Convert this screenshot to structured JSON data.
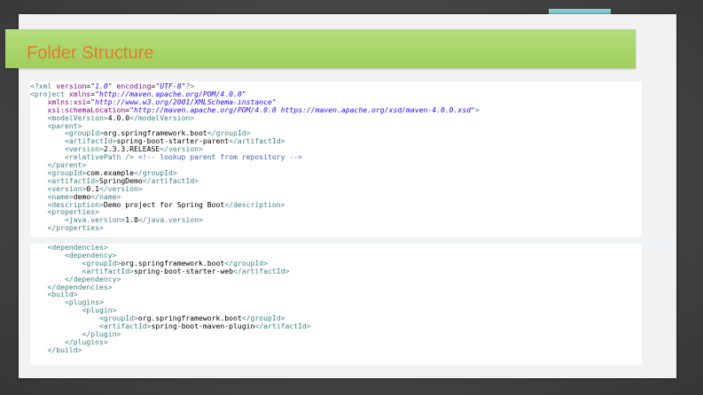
{
  "slide": {
    "title": "Folder Structure",
    "colors": {
      "title_bar": "#a8d468",
      "title_text": "#e8792a",
      "accent_tab": "#86cfd7",
      "background": "#454545"
    }
  },
  "code": {
    "lines": [
      [
        [
          "pi",
          "<?xml "
        ],
        [
          "attr",
          "version"
        ],
        [
          "txt",
          "="
        ],
        [
          "val",
          "\"1.0\""
        ],
        [
          "txt",
          " "
        ],
        [
          "attr",
          "encoding"
        ],
        [
          "txt",
          "="
        ],
        [
          "val",
          "\"UTF-8\""
        ],
        [
          "pi",
          "?>"
        ]
      ],
      [
        [
          "tag",
          "<project "
        ],
        [
          "attr",
          "xmlns"
        ],
        [
          "txt",
          "="
        ],
        [
          "val",
          "\"http://maven.apache.org/POM/4.0.0\""
        ]
      ],
      [
        [
          "txt",
          "    "
        ],
        [
          "attr",
          "xmlns:xsi"
        ],
        [
          "txt",
          "="
        ],
        [
          "val",
          "\"http://www.w3.org/2001/XMLSchema-instance\""
        ]
      ],
      [
        [
          "txt",
          "    "
        ],
        [
          "attr",
          "xsi:schemaLocation"
        ],
        [
          "txt",
          "="
        ],
        [
          "val",
          "\"http://maven.apache.org/POM/4.0.0 https://maven.apache.org/xsd/maven-4.0.0.xsd\""
        ],
        [
          "tag",
          ">"
        ]
      ],
      [
        [
          "txt",
          "    "
        ],
        [
          "tag",
          "<modelVersion>"
        ],
        [
          "txt",
          "4.0.0"
        ],
        [
          "tag",
          "</modelVersion>"
        ]
      ],
      [
        [
          "txt",
          "    "
        ],
        [
          "tag",
          "<parent>"
        ]
      ],
      [
        [
          "txt",
          "        "
        ],
        [
          "tag",
          "<groupId>"
        ],
        [
          "txt",
          "org.springframework.boot"
        ],
        [
          "tag",
          "</groupId>"
        ]
      ],
      [
        [
          "txt",
          "        "
        ],
        [
          "tag",
          "<artifactId>"
        ],
        [
          "txt",
          "spring-boot-starter-parent"
        ],
        [
          "tag",
          "</artifactId>"
        ]
      ],
      [
        [
          "txt",
          "        "
        ],
        [
          "tag",
          "<version>"
        ],
        [
          "txt",
          "2.3.3.RELEASE"
        ],
        [
          "tag",
          "</version>"
        ]
      ],
      [
        [
          "txt",
          "        "
        ],
        [
          "tag",
          "<relativePath />"
        ],
        [
          "com",
          " <!-- lookup parent from repository -->"
        ]
      ],
      [
        [
          "txt",
          "    "
        ],
        [
          "tag",
          "</parent>"
        ]
      ],
      [
        [
          "txt",
          "    "
        ],
        [
          "tag",
          "<groupId>"
        ],
        [
          "txt",
          "com.example"
        ],
        [
          "tag",
          "</groupId>"
        ]
      ],
      [
        [
          "txt",
          "    "
        ],
        [
          "tag",
          "<artifactId>"
        ],
        [
          "txt",
          "SpringDemo"
        ],
        [
          "tag",
          "</artifactId>"
        ]
      ],
      [
        [
          "txt",
          "    "
        ],
        [
          "tag",
          "<version>"
        ],
        [
          "txt",
          "0.1"
        ],
        [
          "tag",
          "</version>"
        ]
      ],
      [
        [
          "txt",
          "    "
        ],
        [
          "tag",
          "<name>"
        ],
        [
          "txt",
          "demo"
        ],
        [
          "tag",
          "</name>"
        ]
      ],
      [
        [
          "txt",
          "    "
        ],
        [
          "tag",
          "<description>"
        ],
        [
          "txt",
          "Demo project for Spring Boot"
        ],
        [
          "tag",
          "</description>"
        ]
      ],
      [
        [
          "txt",
          "    "
        ],
        [
          "tag",
          "<properties>"
        ]
      ],
      [
        [
          "txt",
          "        "
        ],
        [
          "tag",
          "<java.version>"
        ],
        [
          "txt",
          "1.8"
        ],
        [
          "tag",
          "</java.version>"
        ]
      ],
      [
        [
          "txt",
          "    "
        ],
        [
          "tag",
          "</properties>"
        ]
      ],
      [],
      [
        [
          "txt",
          "    "
        ],
        [
          "tag",
          "<dependencies>"
        ]
      ],
      [
        [
          "txt",
          "        "
        ],
        [
          "tag",
          "<dependency>"
        ]
      ],
      [
        [
          "txt",
          "            "
        ],
        [
          "tag",
          "<groupId>"
        ],
        [
          "txt",
          "org.springframework.boot"
        ],
        [
          "tag",
          "</groupId>"
        ]
      ],
      [
        [
          "txt",
          "            "
        ],
        [
          "tag",
          "<artifactId>"
        ],
        [
          "txt",
          "spring-boot-starter-web"
        ],
        [
          "tag",
          "</artifactId>"
        ]
      ],
      [
        [
          "txt",
          "        "
        ],
        [
          "tag",
          "</dependency>"
        ]
      ],
      [
        [
          "txt",
          "    "
        ],
        [
          "tag",
          "</dependencies>"
        ]
      ],
      [
        [
          "txt",
          "    "
        ],
        [
          "tag",
          "<build>"
        ]
      ],
      [
        [
          "txt",
          "        "
        ],
        [
          "tag",
          "<plugins>"
        ]
      ],
      [
        [
          "txt",
          "            "
        ],
        [
          "tag",
          "<plugin>"
        ]
      ],
      [
        [
          "txt",
          "                "
        ],
        [
          "tag",
          "<groupId>"
        ],
        [
          "txt",
          "org.springframework.boot"
        ],
        [
          "tag",
          "</groupId>"
        ]
      ],
      [
        [
          "txt",
          "                "
        ],
        [
          "tag",
          "<artifactId>"
        ],
        [
          "txt",
          "spring-boot-maven-plugin"
        ],
        [
          "tag",
          "</artifactId>"
        ]
      ],
      [
        [
          "txt",
          "            "
        ],
        [
          "tag",
          "</plugin>"
        ]
      ],
      [
        [
          "txt",
          "        "
        ],
        [
          "tag",
          "</plugins>"
        ]
      ],
      [
        [
          "txt",
          "    "
        ],
        [
          "tag",
          "</build>"
        ]
      ]
    ]
  }
}
